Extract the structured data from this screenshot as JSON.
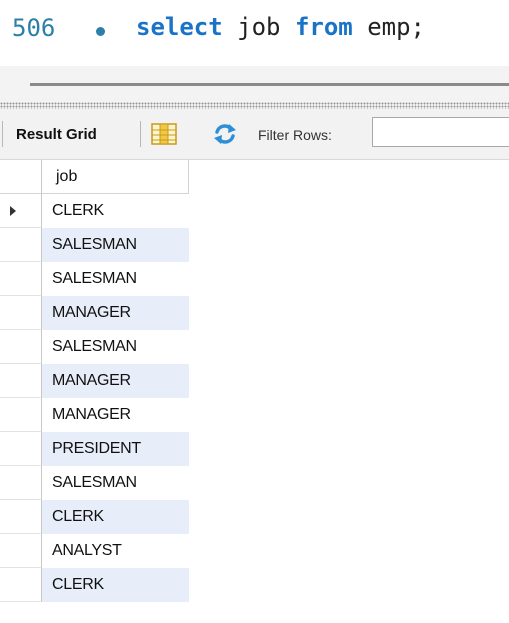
{
  "editor": {
    "line_number": "506",
    "code_tokens": [
      {
        "text": "select",
        "kw": true
      },
      {
        "text": " job ",
        "kw": false
      },
      {
        "text": "from",
        "kw": true
      },
      {
        "text": " emp;",
        "kw": false
      }
    ]
  },
  "toolbar": {
    "result_grid_label": "Result Grid",
    "filter_label": "Filter Rows:",
    "filter_value": ""
  },
  "grid": {
    "columns": [
      "job"
    ],
    "rows": [
      "CLERK",
      "SALESMAN",
      "SALESMAN",
      "MANAGER",
      "SALESMAN",
      "MANAGER",
      "MANAGER",
      "PRESIDENT",
      "SALESMAN",
      "CLERK",
      "ANALYST",
      "CLERK"
    ],
    "current_row": 0
  },
  "colors": {
    "keyword": "#1a73c7",
    "line_number": "#2c7fa8",
    "alt_row": "#e8eef9"
  }
}
